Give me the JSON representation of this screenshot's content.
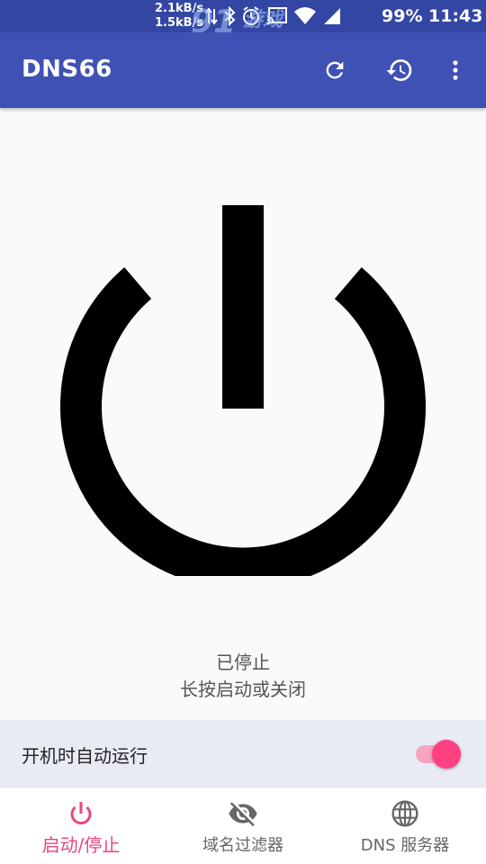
{
  "status_bar": {
    "net_up": "2.1kB/s",
    "net_down": "1.5kB/s",
    "battery": "99%",
    "time": "11:43",
    "icons": [
      "arrows-icon",
      "bluetooth-icon",
      "alarm-icon",
      "cast-icon",
      "wifi-icon",
      "signal-icon"
    ],
    "watermark_text": "游戏",
    "watermark_url": "91danji.com"
  },
  "app_bar": {
    "title": "DNS66",
    "actions": [
      "refresh-icon",
      "history-icon",
      "more-vert-icon"
    ]
  },
  "main": {
    "power_icon": "power-icon",
    "status": "已停止",
    "hint": "长按启动或关闭"
  },
  "autostart": {
    "label": "开机时自动运行",
    "enabled": true
  },
  "bottom_nav": {
    "items": [
      {
        "label": "启动/停止",
        "icon": "power-icon",
        "active": true
      },
      {
        "label": "域名过滤器",
        "icon": "eye-off-icon",
        "active": false
      },
      {
        "label": "DNS 服务器",
        "icon": "globe-icon",
        "active": false
      }
    ]
  },
  "colors": {
    "primary": "#3f51b5",
    "primary_dark": "#3446a3",
    "accent": "#ff4081",
    "nav_active": "#e8467c"
  }
}
